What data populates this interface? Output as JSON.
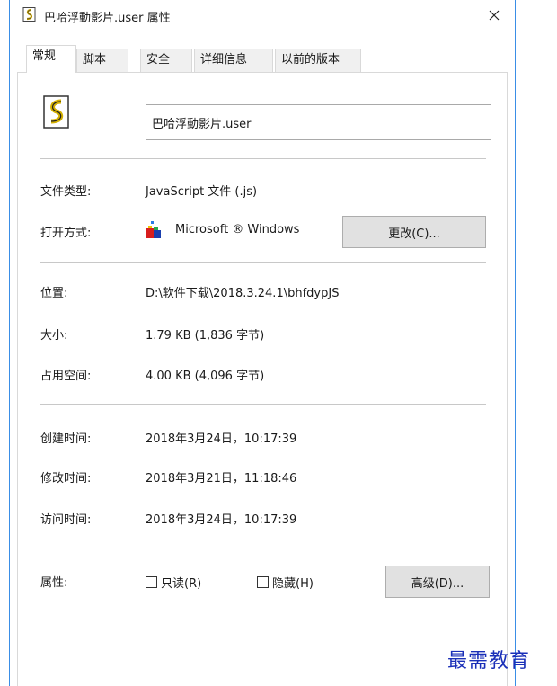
{
  "window": {
    "title": "巴哈浮動影片.user 属性"
  },
  "tabs": [
    {
      "label": "常规",
      "active": true
    },
    {
      "label": "脚本",
      "active": false
    },
    {
      "label": "安全",
      "active": false
    },
    {
      "label": "详细信息",
      "active": false
    },
    {
      "label": "以前的版本",
      "active": false
    }
  ],
  "general": {
    "filename": "巴哈浮動影片.user",
    "type_label": "文件类型:",
    "type_value": "JavaScript 文件 (.js)",
    "open_with_label": "打开方式:",
    "open_with_value": "Microsoft ® Windows",
    "change_button": "更改(C)...",
    "location_label": "位置:",
    "location_value": "D:\\软件下载\\2018.3.24.1\\bhfdypJS",
    "size_label": "大小:",
    "size_value": "1.79 KB (1,836 字节)",
    "disk_size_label": "占用空间:",
    "disk_size_value": "4.00 KB (4,096 字节)",
    "created_label": "创建时间:",
    "created_value": "2018年3月24日，10:17:39",
    "modified_label": "修改时间:",
    "modified_value": "2018年3月21日，11:18:46",
    "accessed_label": "访问时间:",
    "accessed_value": "2018年3月24日，10:17:39",
    "attributes_label": "属性:",
    "readonly_label": "只读(R)",
    "readonly_checked": false,
    "hidden_label": "隐藏(H)",
    "hidden_checked": false,
    "advanced_button": "高级(D)..."
  },
  "watermark": "最需教育",
  "colors": {
    "window_border": "#3a8ee6",
    "watermark": "#1a2fb8",
    "button_bg": "#e1e1e1"
  }
}
